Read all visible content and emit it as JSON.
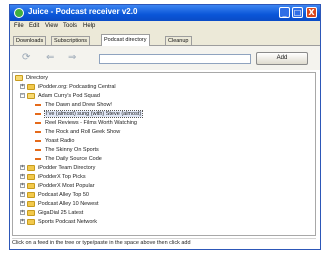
{
  "window": {
    "title": "Juice - Podcast receiver v2.0",
    "controls": {
      "minimize": "_",
      "maximize": "□",
      "close": "X"
    }
  },
  "menu": [
    "File",
    "Edit",
    "View",
    "Tools",
    "Help"
  ],
  "tabs": [
    {
      "label": "Downloads",
      "active": false
    },
    {
      "label": "Subscriptions",
      "active": false
    },
    {
      "label": "Podcast directory",
      "active": true
    },
    {
      "label": "Cleanup",
      "active": false
    }
  ],
  "toolbar": {
    "icons": [
      "refresh-icon",
      "back-icon",
      "forward-icon"
    ],
    "url_value": "",
    "add_label": "Add"
  },
  "tree": {
    "root": "Directory",
    "items": [
      {
        "label": "iPodder.org: Podcasting Central",
        "kind": "folder",
        "expanded": false
      },
      {
        "label": "Adam Curry's Pod Squad",
        "kind": "folder",
        "expanded": true
      },
      {
        "label": "The Dawn and Drew Show!",
        "kind": "feed"
      },
      {
        "label": "I've (almost) sung (with) Steve (almost)",
        "kind": "feed",
        "selected": true
      },
      {
        "label": "Reel Reviews - Films Worth Watching",
        "kind": "feed"
      },
      {
        "label": "The Rock and Roll Geek Show",
        "kind": "feed"
      },
      {
        "label": "Yoast Radio",
        "kind": "feed"
      },
      {
        "label": "The Skinny On Sports",
        "kind": "feed"
      },
      {
        "label": "The Daily Source Code",
        "kind": "feed"
      },
      {
        "label": "iPodder Team Directory",
        "kind": "folder",
        "expanded": false
      },
      {
        "label": "iPodderX Top Picks",
        "kind": "folder",
        "expanded": false
      },
      {
        "label": "iPodderX Most Popular",
        "kind": "folder",
        "expanded": false
      },
      {
        "label": "Podcast Alley Top 50",
        "kind": "folder",
        "expanded": false
      },
      {
        "label": "Podcast Alley 10 Newest",
        "kind": "folder",
        "expanded": false
      },
      {
        "label": "GigaDial 25 Latest",
        "kind": "folder",
        "expanded": false
      },
      {
        "label": "Sports Podcast Network",
        "kind": "folder",
        "expanded": false
      }
    ]
  },
  "status": "Click on a feed in the tree or type/paste in the space above then click add",
  "colors": {
    "titlebar": "#0a56d8",
    "feed_dash": "#e56a1a",
    "folder": "#f2c94c"
  }
}
